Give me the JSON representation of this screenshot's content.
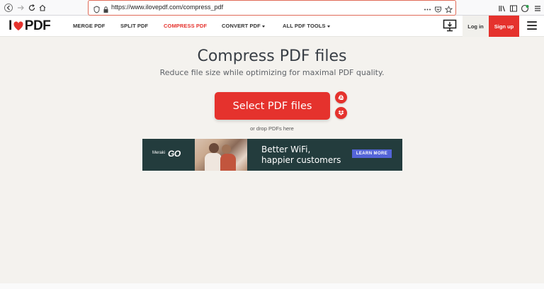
{
  "browser": {
    "url": "https://www.ilovepdf.com/compress_pdf",
    "icons": [
      "back-icon",
      "forward-icon",
      "reload-icon",
      "home-icon",
      "shield-icon",
      "lock-icon",
      "more-icon",
      "pocket-icon",
      "bookmark-star-icon",
      "library-icon",
      "sidebar-icon",
      "extension-icon",
      "menu-icon"
    ]
  },
  "header": {
    "logo_left": "I",
    "logo_right": "PDF",
    "nav": [
      {
        "label": "MERGE PDF",
        "active": false,
        "dropdown": false
      },
      {
        "label": "SPLIT PDF",
        "active": false,
        "dropdown": false
      },
      {
        "label": "COMPRESS PDF",
        "active": true,
        "dropdown": false
      },
      {
        "label": "CONVERT PDF",
        "active": false,
        "dropdown": true
      },
      {
        "label": "ALL PDF TOOLS",
        "active": false,
        "dropdown": true
      }
    ],
    "login_label": "Log in",
    "signup_label": "Sign up"
  },
  "main": {
    "title": "Compress PDF files",
    "subtitle": "Reduce file size while optimizing for maximal PDF quality.",
    "select_label": "Select PDF files",
    "drop_text": "or drop PDFs here"
  },
  "ad": {
    "brand": "Meraki",
    "brand_logo": "GO",
    "headline_line1": "Better WiFi,",
    "headline_line2": "happier customers",
    "cta": "LEARN MORE"
  },
  "colors": {
    "accent": "#e5322d",
    "background": "#f4f2ee",
    "ad_bg": "#233c3d",
    "ad_cta": "#5464d8"
  }
}
